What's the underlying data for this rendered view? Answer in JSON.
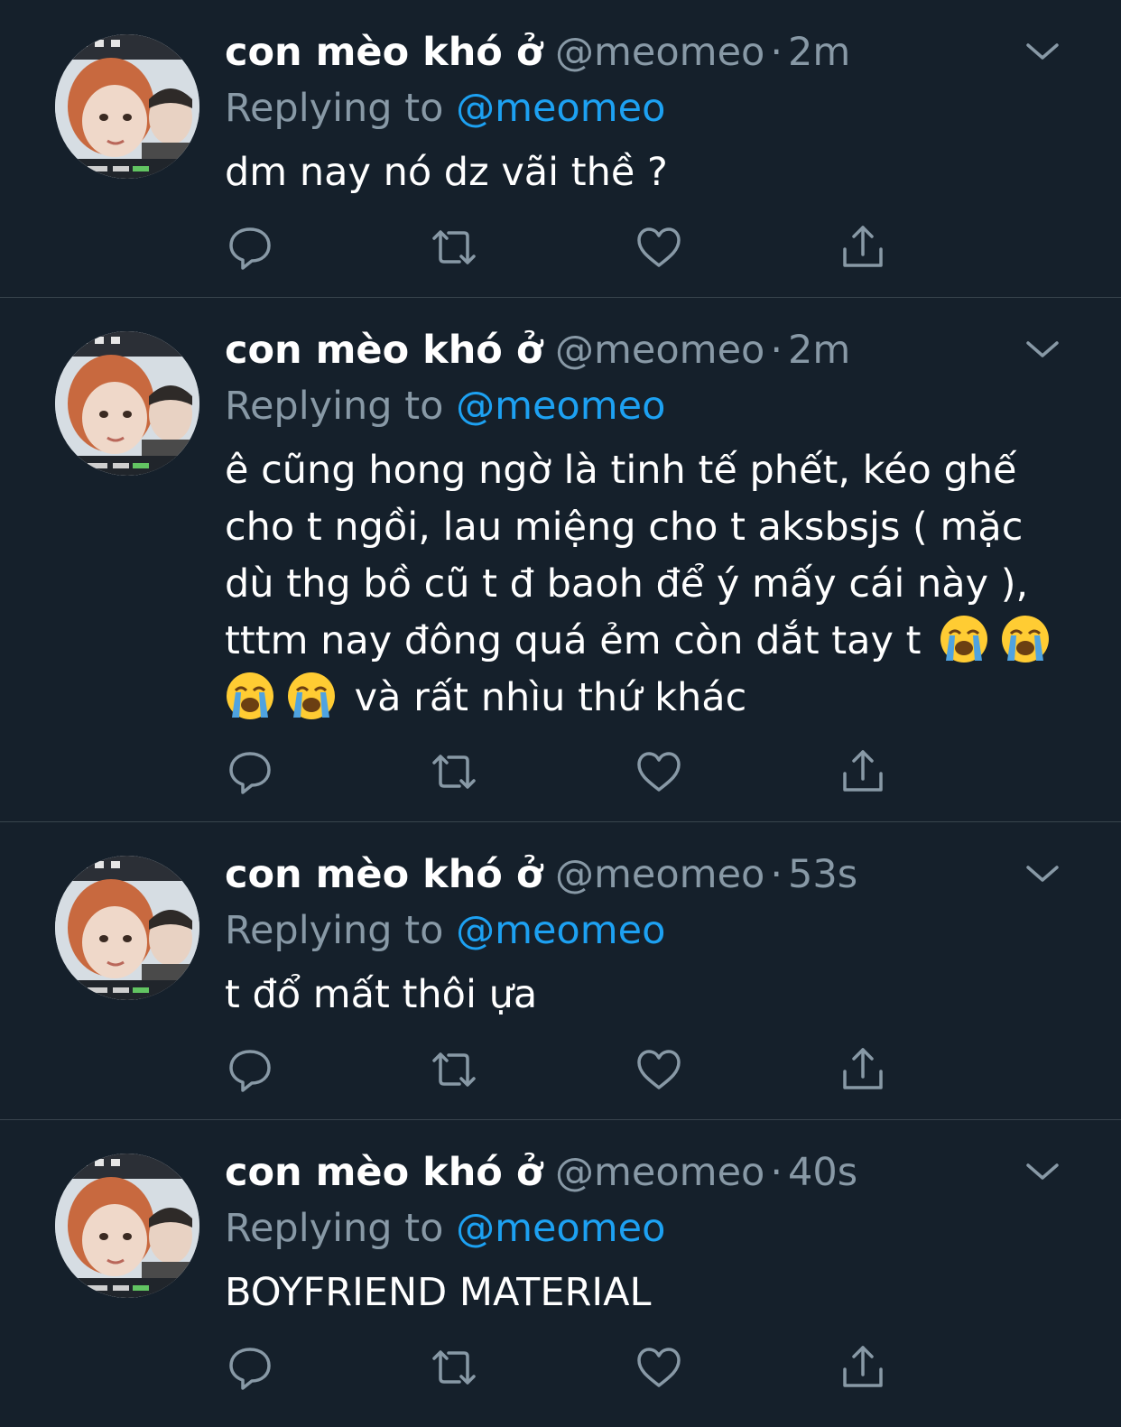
{
  "colors": {
    "background": "#15202b",
    "divider": "#38444d",
    "secondary_text": "#8899a6",
    "link": "#1da1f2",
    "primary_text": "#ffffff"
  },
  "tweets": [
    {
      "display_name": "con mèo khó ở",
      "handle": "@meomeo",
      "separator": "·",
      "time": "2m",
      "replying_label": "Replying to",
      "replying_handle": "@meomeo",
      "text": "dm nay nó dz vãi thề ?"
    },
    {
      "display_name": "con mèo khó ở",
      "handle": "@meomeo",
      "separator": "·",
      "time": "2m",
      "replying_label": "Replying to",
      "replying_handle": "@meomeo",
      "text_line_1": "ê cũng hong ngờ là tinh tế phết, kéo ghế",
      "text_line_2": "cho t ngồi, lau miệng cho t aksbsjs ( mặc",
      "text_line_3": "dù thg bồ cũ t đ baoh để ý mấy cái này ),",
      "text_line_4": "tttm nay đông quá ẻm còn dắt tay t",
      "text_line_5": "và rất nhìu thứ khác",
      "emoji": "loudly-crying-face"
    },
    {
      "display_name": "con mèo khó ở",
      "handle": "@meomeo",
      "separator": "·",
      "time": "53s",
      "replying_label": "Replying to",
      "replying_handle": "@meomeo",
      "text": "t đổ mất thôi ựa"
    },
    {
      "display_name": "con mèo khó ở",
      "handle": "@meomeo",
      "separator": "·",
      "time": "40s",
      "replying_label": "Replying to",
      "replying_handle": "@meomeo",
      "text": "BOYFRIEND MATERIAL"
    }
  ],
  "icons": {
    "reply": "speech-bubble-icon",
    "retweet": "retweet-arrows-icon",
    "like": "heart-icon",
    "share": "share-upload-icon",
    "menu": "chevron-down-icon"
  }
}
